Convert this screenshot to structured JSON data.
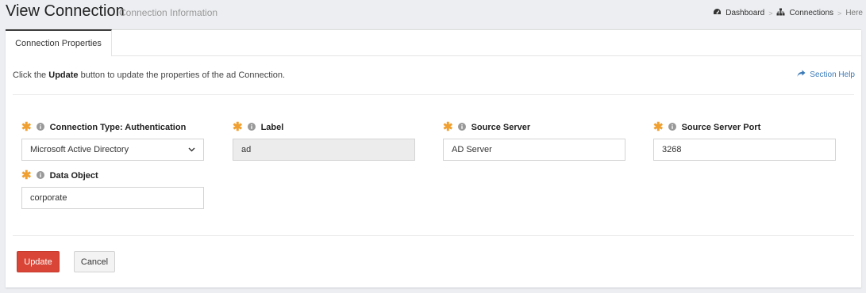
{
  "header": {
    "title": "View Connection",
    "subtitle": "Connection Information"
  },
  "breadcrumb": {
    "items": [
      {
        "label": "Dashboard",
        "icon": "dashboard-icon"
      },
      {
        "label": "Connections",
        "icon": "sitemap-icon"
      },
      {
        "label": "Here",
        "icon": ""
      }
    ],
    "separator": ">"
  },
  "tabs": [
    {
      "label": "Connection Properties",
      "active": true
    }
  ],
  "intro": {
    "before": "Click the ",
    "bold": "Update",
    "after": " button to update the properties of the ad Connection."
  },
  "section_help": {
    "label": "Section Help",
    "icon": "share-arrow-icon"
  },
  "fields": {
    "connection_type": {
      "label": "Connection Type: Authentication",
      "value": "Microsoft Active Directory",
      "type": "select"
    },
    "label": {
      "label": "Label",
      "value": "ad",
      "readonly": true
    },
    "source_server": {
      "label": "Source Server",
      "value": "AD Server"
    },
    "source_server_port": {
      "label": "Source Server Port",
      "value": "3268"
    },
    "data_object": {
      "label": "Data Object",
      "value": "corporate"
    }
  },
  "buttons": {
    "update": "Update",
    "cancel": "Cancel"
  },
  "colors": {
    "required": "#f0a030",
    "primary_button": "#d94536",
    "link": "#3a7ab8"
  }
}
